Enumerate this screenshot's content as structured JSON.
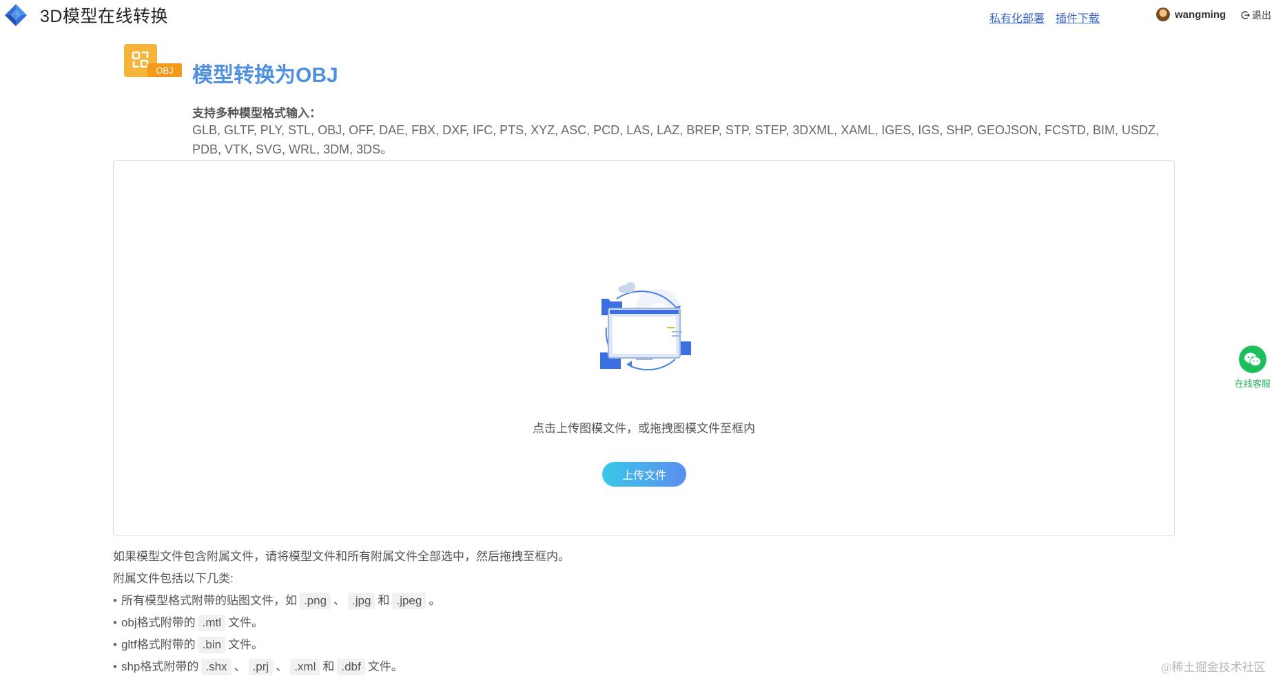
{
  "header": {
    "title": "3D模型在线转换",
    "links": [
      "私有化部署",
      "插件下载"
    ],
    "username": "wangming",
    "logout_label": "退出"
  },
  "main": {
    "badge_text": "OBJ",
    "page_title": "模型转换为OBJ",
    "formats_label": "支持多种模型格式输入：",
    "formats_list": "GLB, GLTF, PLY, STL, OBJ, OFF, DAE, FBX, DXF, IFC, PTS, XYZ, ASC, PCD, LAS, LAZ, BREP, STP, STEP, 3DXML, XAML, IGES, IGS, SHP, GEOJSON, FCSTD, BIM, USDZ, PDB, VTK, SVG, WRL, 3DM, 3DS。"
  },
  "dropzone": {
    "hint": "点击上传图模文件，或拖拽图模文件至框内",
    "upload_label": "上传文件"
  },
  "notes": {
    "line1": "如果模型文件包含附属文件，请将模型文件和所有附属文件全部选中，然后拖拽至框内。",
    "line2": "附属文件包括以下几类:",
    "bullet": "•",
    "item1": {
      "prefix": "所有模型格式附带的贴图文件，如",
      "code1": ".png",
      "sep1": "、",
      "code2": ".jpg",
      "and": "和",
      "code3": ".jpeg",
      "suffix": "。"
    },
    "item2": {
      "prefix": "obj格式附带的",
      "code1": ".mtl",
      "suffix": "文件。"
    },
    "item3": {
      "prefix": "gltf格式附带的",
      "code1": ".bin",
      "suffix": "文件。"
    },
    "item4": {
      "prefix": "shp格式附带的",
      "code1": ".shx",
      "sep1": "、",
      "code2": ".prj",
      "sep2": "、",
      "code3": ".xml",
      "and": "和",
      "code4": ".dbf",
      "suffix": "文件。"
    }
  },
  "support": {
    "label": "在线客服"
  },
  "watermark": "@稀土掘金技术社区",
  "colors": {
    "accent": "#4f8fe0",
    "link": "#3a66c7",
    "button_start": "#39c7e8",
    "button_end": "#5b8ef0",
    "badge": "#f5a623",
    "support": "#1bbf5c"
  }
}
